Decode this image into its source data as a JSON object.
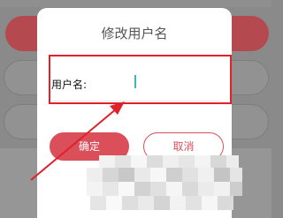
{
  "dialog": {
    "title": "修改用户名",
    "username_label": "用户名:",
    "username_value": "",
    "confirm_label": "确定",
    "cancel_label": "取消"
  },
  "colors": {
    "accent": "#da4f5a",
    "annotation": "#e0202a",
    "cursor": "#3fb8b0",
    "overlay": "#8a8a8a"
  }
}
